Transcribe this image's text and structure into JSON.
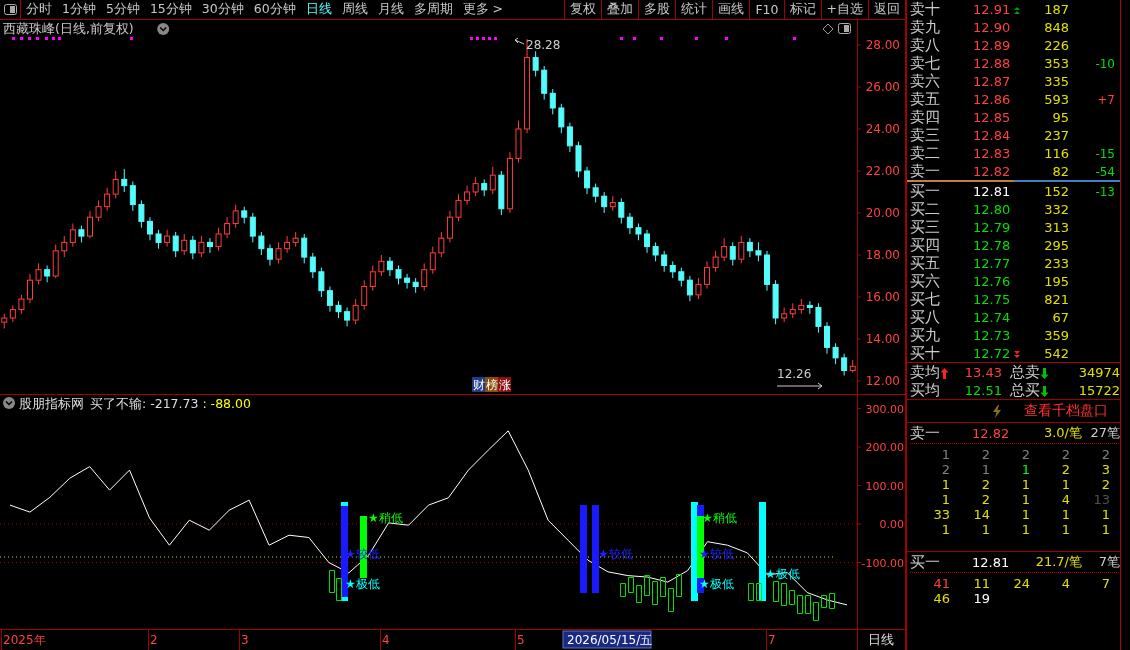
{
  "toolbar": {
    "periods": [
      {
        "label": "分时",
        "selected": false
      },
      {
        "label": "1分钟",
        "selected": false
      },
      {
        "label": "5分钟",
        "selected": false
      },
      {
        "label": "15分钟",
        "selected": false
      },
      {
        "label": "30分钟",
        "selected": false
      },
      {
        "label": "60分钟",
        "selected": false
      },
      {
        "label": "日线",
        "selected": true
      },
      {
        "label": "周线",
        "selected": false
      },
      {
        "label": "月线",
        "selected": false
      },
      {
        "label": "多周期",
        "selected": false
      },
      {
        "label": "更多 >",
        "selected": false
      }
    ],
    "buttons": [
      "复权",
      "叠加",
      "多股",
      "统计",
      "画线",
      "F10",
      "标记",
      "+自选",
      "返回"
    ]
  },
  "price_chart": {
    "title": "西藏珠峰(日线,前复权)",
    "high_label": "28.28",
    "low_label": "12.26",
    "badges": [
      {
        "text": "财",
        "color": "#1c3c8c"
      },
      {
        "text": "榜",
        "color": "#8c4a0c"
      },
      {
        "text": "涨",
        "color": "#8c1010"
      }
    ],
    "chart_data": {
      "type": "candlestick",
      "ylim": [
        11.38,
        29.19
      ],
      "yticks": [
        {
          "value": 28,
          "label": "28.00"
        },
        {
          "value": 26,
          "label": "26.00"
        },
        {
          "value": 24,
          "label": "24.00"
        },
        {
          "value": 22,
          "label": "22.00"
        },
        {
          "value": 20,
          "label": "20.00"
        },
        {
          "value": 18,
          "label": "18.00"
        },
        {
          "value": 16,
          "label": "16.00"
        },
        {
          "value": 14,
          "label": "14.00"
        },
        {
          "value": 12,
          "label": "12.00"
        }
      ],
      "ohlc": [
        [
          14.8,
          15.2,
          14.5,
          15.0
        ],
        [
          15.0,
          15.6,
          14.8,
          15.4
        ],
        [
          15.4,
          16.1,
          15.2,
          15.9
        ],
        [
          15.9,
          17.1,
          15.7,
          16.8
        ],
        [
          16.8,
          17.6,
          16.6,
          17.3
        ],
        [
          17.3,
          17.5,
          16.7,
          17.0
        ],
        [
          17.0,
          18.5,
          16.9,
          18.2
        ],
        [
          18.2,
          18.9,
          17.9,
          18.6
        ],
        [
          18.6,
          19.5,
          18.4,
          19.2
        ],
        [
          19.2,
          19.4,
          18.6,
          18.9
        ],
        [
          18.9,
          20.1,
          18.8,
          19.8
        ],
        [
          19.8,
          20.6,
          19.6,
          20.3
        ],
        [
          20.3,
          21.2,
          20.1,
          20.9
        ],
        [
          20.9,
          22.0,
          20.7,
          21.6
        ],
        [
          21.6,
          22.1,
          21.0,
          21.3
        ],
        [
          21.3,
          21.5,
          20.1,
          20.4
        ],
        [
          20.4,
          20.6,
          19.3,
          19.6
        ],
        [
          19.6,
          19.8,
          18.7,
          19.0
        ],
        [
          19.0,
          19.2,
          18.3,
          18.6
        ],
        [
          18.6,
          19.2,
          18.4,
          18.9
        ],
        [
          18.9,
          19.1,
          17.9,
          18.2
        ],
        [
          18.2,
          19.0,
          18.0,
          18.7
        ],
        [
          18.7,
          18.9,
          17.8,
          18.1
        ],
        [
          18.1,
          18.9,
          17.9,
          18.6
        ],
        [
          18.6,
          18.8,
          18.1,
          18.4
        ],
        [
          18.4,
          19.3,
          18.2,
          19.0
        ],
        [
          19.0,
          19.8,
          18.8,
          19.5
        ],
        [
          19.5,
          20.4,
          19.3,
          20.1
        ],
        [
          20.1,
          20.3,
          19.5,
          19.8
        ],
        [
          19.8,
          20.0,
          18.6,
          18.9
        ],
        [
          18.9,
          19.1,
          18.0,
          18.3
        ],
        [
          18.3,
          18.5,
          17.5,
          17.8
        ],
        [
          17.8,
          18.6,
          17.6,
          18.3
        ],
        [
          18.3,
          18.9,
          18.1,
          18.6
        ],
        [
          18.6,
          19.1,
          18.4,
          18.8
        ],
        [
          18.8,
          19.0,
          17.6,
          17.9
        ],
        [
          17.9,
          18.1,
          16.9,
          17.2
        ],
        [
          17.2,
          17.4,
          16.0,
          16.3
        ],
        [
          16.3,
          16.5,
          15.3,
          15.6
        ],
        [
          15.6,
          15.8,
          15.0,
          15.3
        ],
        [
          15.3,
          15.5,
          14.6,
          14.9
        ],
        [
          14.9,
          15.9,
          14.7,
          15.6
        ],
        [
          15.6,
          16.8,
          15.4,
          16.5
        ],
        [
          16.5,
          17.5,
          16.3,
          17.2
        ],
        [
          17.2,
          18.0,
          17.0,
          17.7
        ],
        [
          17.7,
          17.9,
          17.0,
          17.3
        ],
        [
          17.3,
          17.5,
          16.6,
          16.9
        ],
        [
          16.9,
          17.1,
          16.4,
          16.7
        ],
        [
          16.7,
          16.9,
          16.2,
          16.5
        ],
        [
          16.5,
          17.6,
          16.3,
          17.3
        ],
        [
          17.3,
          18.4,
          17.1,
          18.1
        ],
        [
          18.1,
          19.1,
          17.9,
          18.8
        ],
        [
          18.8,
          20.1,
          18.6,
          19.8
        ],
        [
          19.8,
          20.9,
          19.6,
          20.6
        ],
        [
          20.6,
          21.3,
          20.4,
          21.0
        ],
        [
          21.0,
          21.7,
          20.8,
          21.4
        ],
        [
          21.4,
          21.6,
          20.8,
          21.1
        ],
        [
          21.1,
          22.2,
          20.9,
          21.8
        ],
        [
          21.8,
          22.0,
          19.9,
          20.2
        ],
        [
          20.2,
          22.9,
          20.0,
          22.6
        ],
        [
          22.6,
          24.4,
          22.4,
          24.0
        ],
        [
          24.0,
          28.28,
          23.8,
          27.4
        ],
        [
          27.4,
          27.7,
          26.5,
          26.8
        ],
        [
          26.8,
          27.0,
          25.4,
          25.7
        ],
        [
          25.7,
          25.9,
          24.7,
          25.0
        ],
        [
          25.0,
          25.2,
          23.8,
          24.1
        ],
        [
          24.1,
          24.3,
          22.9,
          23.2
        ],
        [
          23.2,
          23.4,
          21.7,
          22.0
        ],
        [
          22.0,
          22.2,
          20.9,
          21.2
        ],
        [
          21.2,
          21.4,
          20.5,
          20.8
        ],
        [
          20.8,
          21.0,
          20.0,
          20.3
        ],
        [
          20.3,
          20.8,
          20.1,
          20.5
        ],
        [
          20.5,
          20.7,
          19.5,
          19.8
        ],
        [
          19.8,
          20.0,
          19.0,
          19.3
        ],
        [
          19.3,
          19.5,
          18.7,
          19.0
        ],
        [
          19.0,
          19.2,
          18.1,
          18.4
        ],
        [
          18.4,
          18.6,
          17.7,
          18.0
        ],
        [
          18.0,
          18.2,
          17.2,
          17.5
        ],
        [
          17.5,
          17.7,
          16.9,
          17.2
        ],
        [
          17.2,
          17.4,
          16.5,
          16.8
        ],
        [
          16.8,
          17.0,
          15.8,
          16.1
        ],
        [
          16.1,
          16.9,
          15.9,
          16.6
        ],
        [
          16.6,
          17.7,
          16.4,
          17.4
        ],
        [
          17.4,
          18.2,
          17.2,
          17.9
        ],
        [
          17.9,
          18.8,
          17.7,
          18.4
        ],
        [
          18.4,
          18.6,
          17.5,
          17.8
        ],
        [
          17.8,
          18.9,
          17.6,
          18.6
        ],
        [
          18.6,
          18.8,
          17.9,
          18.2
        ],
        [
          18.2,
          18.6,
          17.7,
          18.0
        ],
        [
          18.0,
          18.2,
          16.3,
          16.6
        ],
        [
          16.6,
          16.8,
          14.7,
          15.0
        ],
        [
          15.0,
          15.5,
          14.8,
          15.2
        ],
        [
          15.2,
          15.7,
          15.0,
          15.4
        ],
        [
          15.4,
          15.9,
          15.2,
          15.6
        ],
        [
          15.6,
          15.8,
          15.2,
          15.5
        ],
        [
          15.5,
          15.7,
          14.3,
          14.6
        ],
        [
          14.6,
          14.8,
          13.3,
          13.6
        ],
        [
          13.6,
          13.8,
          12.8,
          13.1
        ],
        [
          13.1,
          13.3,
          12.26,
          12.5
        ],
        [
          12.5,
          13.0,
          12.4,
          12.7
        ]
      ]
    }
  },
  "indicator": {
    "source": "股朋指标网",
    "reading": "买了不输: -217.73",
    "reading_2": ": -88.00",
    "chart_data": {
      "type": "line",
      "ylim": [
        -272.7,
        335.1
      ],
      "yticks": [
        {
          "value": 300,
          "label": "300.00"
        },
        {
          "value": 200,
          "label": "200.00"
        },
        {
          "value": 100,
          "label": "100.00"
        },
        {
          "value": 0,
          "label": "0.00"
        },
        {
          "value": -100,
          "label": "-100.00"
        }
      ],
      "series": [
        {
          "color": "#ffffff",
          "values": [
            49,
            31,
            69,
            119,
            149,
            88,
            140,
            16,
            -55,
            10,
            -16,
            36,
            62,
            -55,
            -29,
            -35,
            -100,
            -127,
            -81,
            3,
            -3,
            49,
            68,
            140,
            192,
            242,
            140,
            10,
            -42,
            -94,
            -124,
            -134,
            -138,
            -151,
            -121,
            -46,
            -55,
            -75,
            -132,
            -126,
            -178,
            -197,
            -210
          ]
        }
      ]
    },
    "signals": [
      {
        "text": "★稍低",
        "kind": "slight"
      },
      {
        "text": "★较低",
        "kind": "lower"
      },
      {
        "text": "★极低",
        "kind": "lowest"
      },
      {
        "text": "★较低",
        "kind": "lower"
      },
      {
        "text": "★稍低",
        "kind": "slight"
      },
      {
        "text": "★较低",
        "kind": "lower"
      },
      {
        "text": "★极低",
        "kind": "lowest"
      },
      {
        "text": "★极低",
        "kind": "lowest"
      }
    ]
  },
  "date_axis": {
    "labels": [
      "2025年",
      "2",
      "3",
      "4",
      "5",
      "7"
    ],
    "cursor_date": "2026/05/15/五",
    "period": "日线"
  },
  "order_book": {
    "asks": [
      {
        "label": "卖十",
        "price": "12.91",
        "volume": "187",
        "arrow_up": true
      },
      {
        "label": "卖九",
        "price": "12.90",
        "volume": "848",
        "arrow_up": false
      },
      {
        "label": "卖八",
        "price": "12.89",
        "volume": "226",
        "arrow_up": false
      },
      {
        "label": "卖七",
        "price": "12.88",
        "volume": "353",
        "change": "-10",
        "color": "#00e000",
        "arrow_up": false
      },
      {
        "label": "卖六",
        "price": "12.87",
        "volume": "335",
        "arrow_up": false
      },
      {
        "label": "卖五",
        "price": "12.86",
        "volume": "593",
        "change": "+7",
        "color": "#ff4040",
        "arrow_up": false
      },
      {
        "label": "卖四",
        "price": "12.85",
        "volume": "95",
        "arrow_up": false
      },
      {
        "label": "卖三",
        "price": "12.84",
        "volume": "237",
        "arrow_up": false
      },
      {
        "label": "卖二",
        "price": "12.83",
        "volume": "116",
        "change": "-15",
        "color": "#00e000",
        "arrow_up": false
      },
      {
        "label": "卖一",
        "price": "12.82",
        "volume": "82",
        "change": "-54",
        "color": "#00e000",
        "arrow_up": false
      }
    ],
    "bids": [
      {
        "label": "买一",
        "price": "12.81",
        "volume": "152",
        "change": "-13",
        "color": "#00e000",
        "flat": true,
        "arrow_down": false
      },
      {
        "label": "买二",
        "price": "12.80",
        "volume": "332",
        "flat": false,
        "arrow_down": false
      },
      {
        "label": "买三",
        "price": "12.79",
        "volume": "313",
        "flat": false,
        "arrow_down": false
      },
      {
        "label": "买四",
        "price": "12.78",
        "volume": "295",
        "flat": false,
        "arrow_down": false
      },
      {
        "label": "买五",
        "price": "12.77",
        "volume": "233",
        "flat": false,
        "arrow_down": false
      },
      {
        "label": "买六",
        "price": "12.76",
        "volume": "195",
        "flat": false,
        "arrow_down": false
      },
      {
        "label": "买七",
        "price": "12.75",
        "volume": "821",
        "flat": false,
        "arrow_down": false
      },
      {
        "label": "买八",
        "price": "12.74",
        "volume": "67",
        "flat": false,
        "arrow_down": false
      },
      {
        "label": "买九",
        "price": "12.73",
        "volume": "359",
        "flat": false,
        "arrow_down": false
      },
      {
        "label": "买十",
        "price": "12.72",
        "volume": "542",
        "flat": false,
        "arrow_down": true
      }
    ],
    "averages": [
      {
        "label": "卖均",
        "label_arrow_up": true,
        "price": "13.43",
        "total_label": "总卖",
        "total_arrow_down": true,
        "total": "34974"
      },
      {
        "label": "买均",
        "label_arrow_up": false,
        "price": "12.51",
        "total_label": "总买",
        "total_arrow_down": true,
        "total": "15722"
      }
    ],
    "depth_link": "查看千档盘口",
    "ask_summary": {
      "label": "卖一",
      "price": "12.82",
      "per_order": "3.0/笔",
      "orders": "27笔"
    },
    "ask_queue": [
      {
        "value": "1",
        "color": "#808080"
      },
      {
        "value": "2",
        "color": "#808080"
      },
      {
        "value": "2",
        "color": "#808080"
      },
      {
        "value": "2",
        "color": "#808080"
      },
      {
        "value": "2",
        "color": "#808080"
      },
      {
        "value": "2",
        "color": "#808080"
      },
      {
        "value": "1",
        "color": "#808080"
      },
      {
        "value": "1",
        "color": "#00ff00"
      },
      {
        "value": "2",
        "color": "#e0e000"
      },
      {
        "value": "3",
        "color": "#e0e000"
      },
      {
        "value": "1",
        "color": "#e0e000"
      },
      {
        "value": "2",
        "color": "#e0e000"
      },
      {
        "value": "1",
        "color": "#e0e000"
      },
      {
        "value": "1",
        "color": "#e0e000"
      },
      {
        "value": "2",
        "color": "#e0e000"
      },
      {
        "value": "1",
        "color": "#e0e000"
      },
      {
        "value": "2",
        "color": "#e0e000"
      },
      {
        "value": "1",
        "color": "#e0e000"
      },
      {
        "value": "4",
        "color": "#e0e000"
      },
      {
        "value": "13",
        "color": "#505050"
      },
      {
        "value": "33",
        "color": "#e0e000"
      },
      {
        "value": "14",
        "color": "#e0e000"
      },
      {
        "value": "1",
        "color": "#e0e000"
      },
      {
        "value": "1",
        "color": "#e0e000"
      },
      {
        "value": "1",
        "color": "#e0e000"
      },
      {
        "value": "1",
        "color": "#e0e000"
      },
      {
        "value": "1",
        "color": "#e0e000"
      },
      {
        "value": "1",
        "color": "#e0e000"
      },
      {
        "value": "1",
        "color": "#e0e000"
      },
      {
        "value": "1",
        "color": "#e0e000"
      }
    ],
    "bid_summary": {
      "label": "买一",
      "price": "12.81",
      "per_order": "21.7/笔",
      "orders": "7笔"
    },
    "bid_queue": [
      {
        "value": "41",
        "color": "#ff4040"
      },
      {
        "value": "11",
        "color": "#e0e000"
      },
      {
        "value": "24",
        "color": "#e0e000"
      },
      {
        "value": "4",
        "color": "#e0e000"
      },
      {
        "value": "7",
        "color": "#e0e000"
      },
      {
        "value": "46",
        "color": "#e0e000"
      },
      {
        "value": "19",
        "color": "#ffffff"
      }
    ]
  }
}
